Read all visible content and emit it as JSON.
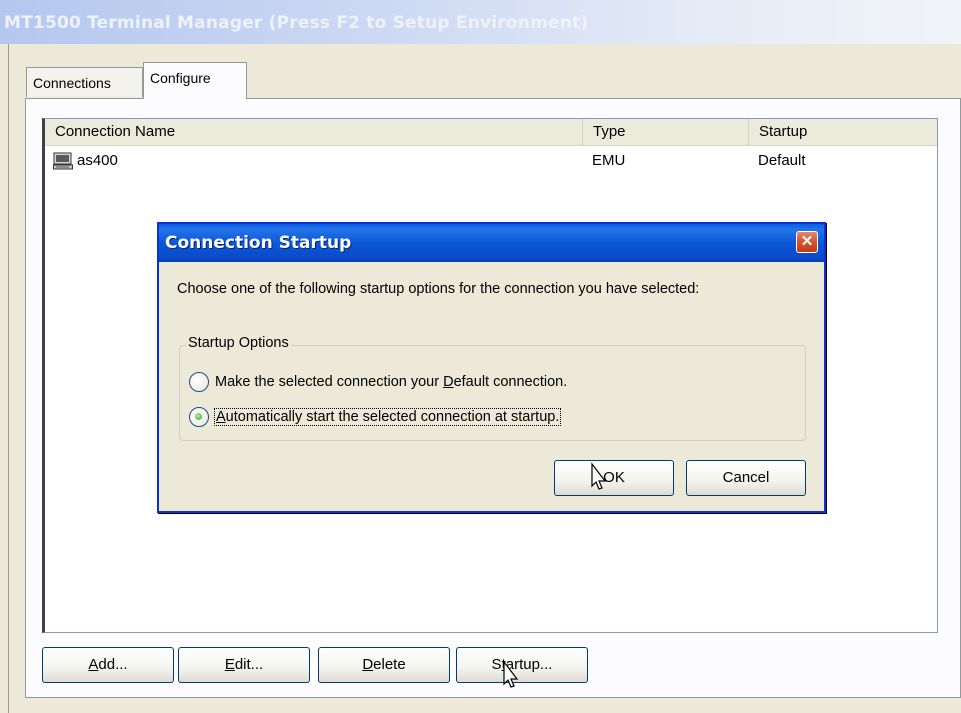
{
  "window": {
    "title": "MT1500 Terminal Manager (Press F2 to Setup Environment)"
  },
  "tabs": [
    {
      "label": "Connections",
      "active": false
    },
    {
      "label": "Configure",
      "active": true
    }
  ],
  "table": {
    "headers": {
      "name": "Connection Name",
      "type": "Type",
      "startup": "Startup"
    },
    "rows": [
      {
        "icon": "terminal-icon",
        "name": "as400",
        "type": "EMU",
        "startup": "Default"
      }
    ]
  },
  "buttons": {
    "add": {
      "pre": "",
      "accel": "A",
      "post": "dd..."
    },
    "edit": {
      "pre": "",
      "accel": "E",
      "post": "dit..."
    },
    "delete": {
      "pre": "",
      "accel": "D",
      "post": "elete"
    },
    "startup": {
      "pre": "S",
      "accel": "t",
      "post": "artup..."
    }
  },
  "dialog": {
    "title": "Connection Startup",
    "close_icon": "close-icon",
    "message": "Choose one of the following startup options for the connection you have selected:",
    "group_label": "Startup Options",
    "options": [
      {
        "pre": "Make the selected connection your ",
        "accel": "D",
        "post": "efault connection.",
        "checked": false
      },
      {
        "pre": "",
        "accel": "A",
        "post": "utomatically start the selected connection at startup.",
        "checked": true
      }
    ],
    "ok": {
      "pre": "O",
      "accel": "",
      "post": "K"
    },
    "cancel": {
      "label": "Cancel"
    }
  },
  "colors": {
    "dialog_titlebar": "#0a58d8",
    "close_button": "#d4532e",
    "window_background": "#ece9d8"
  }
}
